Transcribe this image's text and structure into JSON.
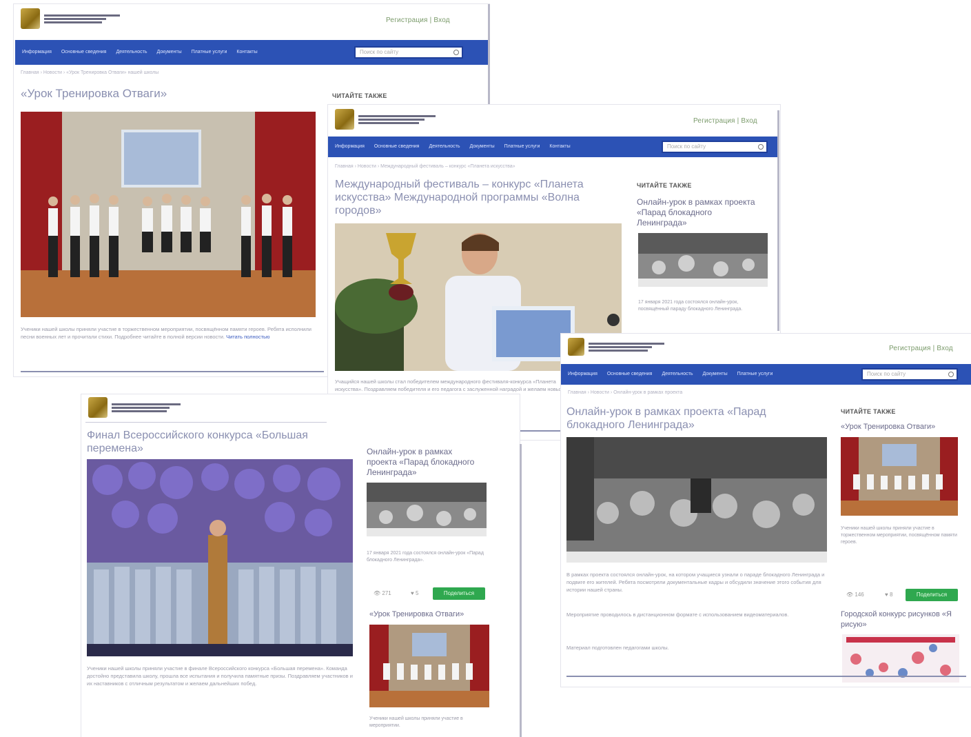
{
  "nav_items": [
    "Информация",
    "Основные сведения",
    "Деятельность",
    "Документы",
    "Платные услуги",
    "Контакты"
  ],
  "search_placeholder": "Поиск по сайту",
  "top_links": "Регистрация | Вход",
  "screens": {
    "s1": {
      "title": "«Урок Тренировка Отваги»",
      "crumb": "Главная › Новости › «Урок Тренировка Отваги» нашей школы",
      "side_heading": "Читайте также",
      "body": "Ученики нашей школы приняли участие в торжественном мероприятии, посвящённом памяти героев. Ребята исполнили песни военных лет и прочитали стихи. Подробнее читайте в полной версии новости.",
      "more": "Читать полностью"
    },
    "s2": {
      "title": "Международный фестиваль – конкурс «Планета искусства» Международной программы «Волна городов»",
      "crumb": "Главная › Новости › Международный фестиваль – конкурс «Планета искусства»",
      "side_heading": "Читайте также",
      "side_title": "Онлайн-урок в рамках проекта «Парад блокадного Ленинграда»",
      "side_caption": "17 января 2021 года состоялся онлайн-урок, посвящённый параду блокадного Ленинграда.",
      "body": "Учащийся нашей школы стал победителем международного фестиваля-конкурса «Планета искусства». Поздравляем победителя и его педагога с заслуженной наградой и желаем новых творческих успехов."
    },
    "s3": {
      "title": "Онлайн-урок в рамках проекта «Парад блокадного Ленинграда»",
      "crumb": "Главная › Новости › Онлайн-урок в рамках проекта",
      "side_heading": "Читайте также",
      "side_title": "«Урок Тренировка Отваги»",
      "side_caption": "Ученики нашей школы приняли участие в торжественном мероприятии, посвящённом памяти героев.",
      "side_heading2": "Городской конкурс рисунков «Я рисую»",
      "meta1": "👁 146",
      "meta2": "♥ 8",
      "btn": "Поделиться",
      "body": "В рамках проекта состоялся онлайн-урок, на котором учащиеся узнали о параде блокадного Ленинграда и подвиге его жителей. Ребята посмотрели документальные кадры и обсудили значение этого события для истории нашей страны.",
      "body2": "Мероприятие проводилось в дистанционном формате с использованием видеоматериалов.",
      "body3": "Материал подготовлен педагогами школы."
    },
    "s4": {
      "title": "Финал Всероссийского конкурса «Большая перемена»",
      "side_title": "Онлайн-урок в рамках проекта «Парад блокадного Ленинграда»",
      "side_caption": "17 января 2021 года состоялся онлайн-урок «Парад блокадного Ленинграда».",
      "side_heading2": "«Урок Тренировка Отваги»",
      "side_caption2": "Ученики нашей школы приняли участие в мероприятии.",
      "meta1": "👁 271",
      "meta2": "♥ 5",
      "btn": "Поделиться",
      "body": "Ученики нашей школы приняли участие в финале Всероссийского конкурса «Большая перемена». Команда достойно представила школу, прошла все испытания и получила памятные призы. Поздравляем участников и их наставников с отличным результатом и желаем дальнейших побед."
    }
  },
  "colors": {
    "nav": "#2c52b5",
    "title": "#8a8fb0",
    "button": "#2fa84f"
  }
}
